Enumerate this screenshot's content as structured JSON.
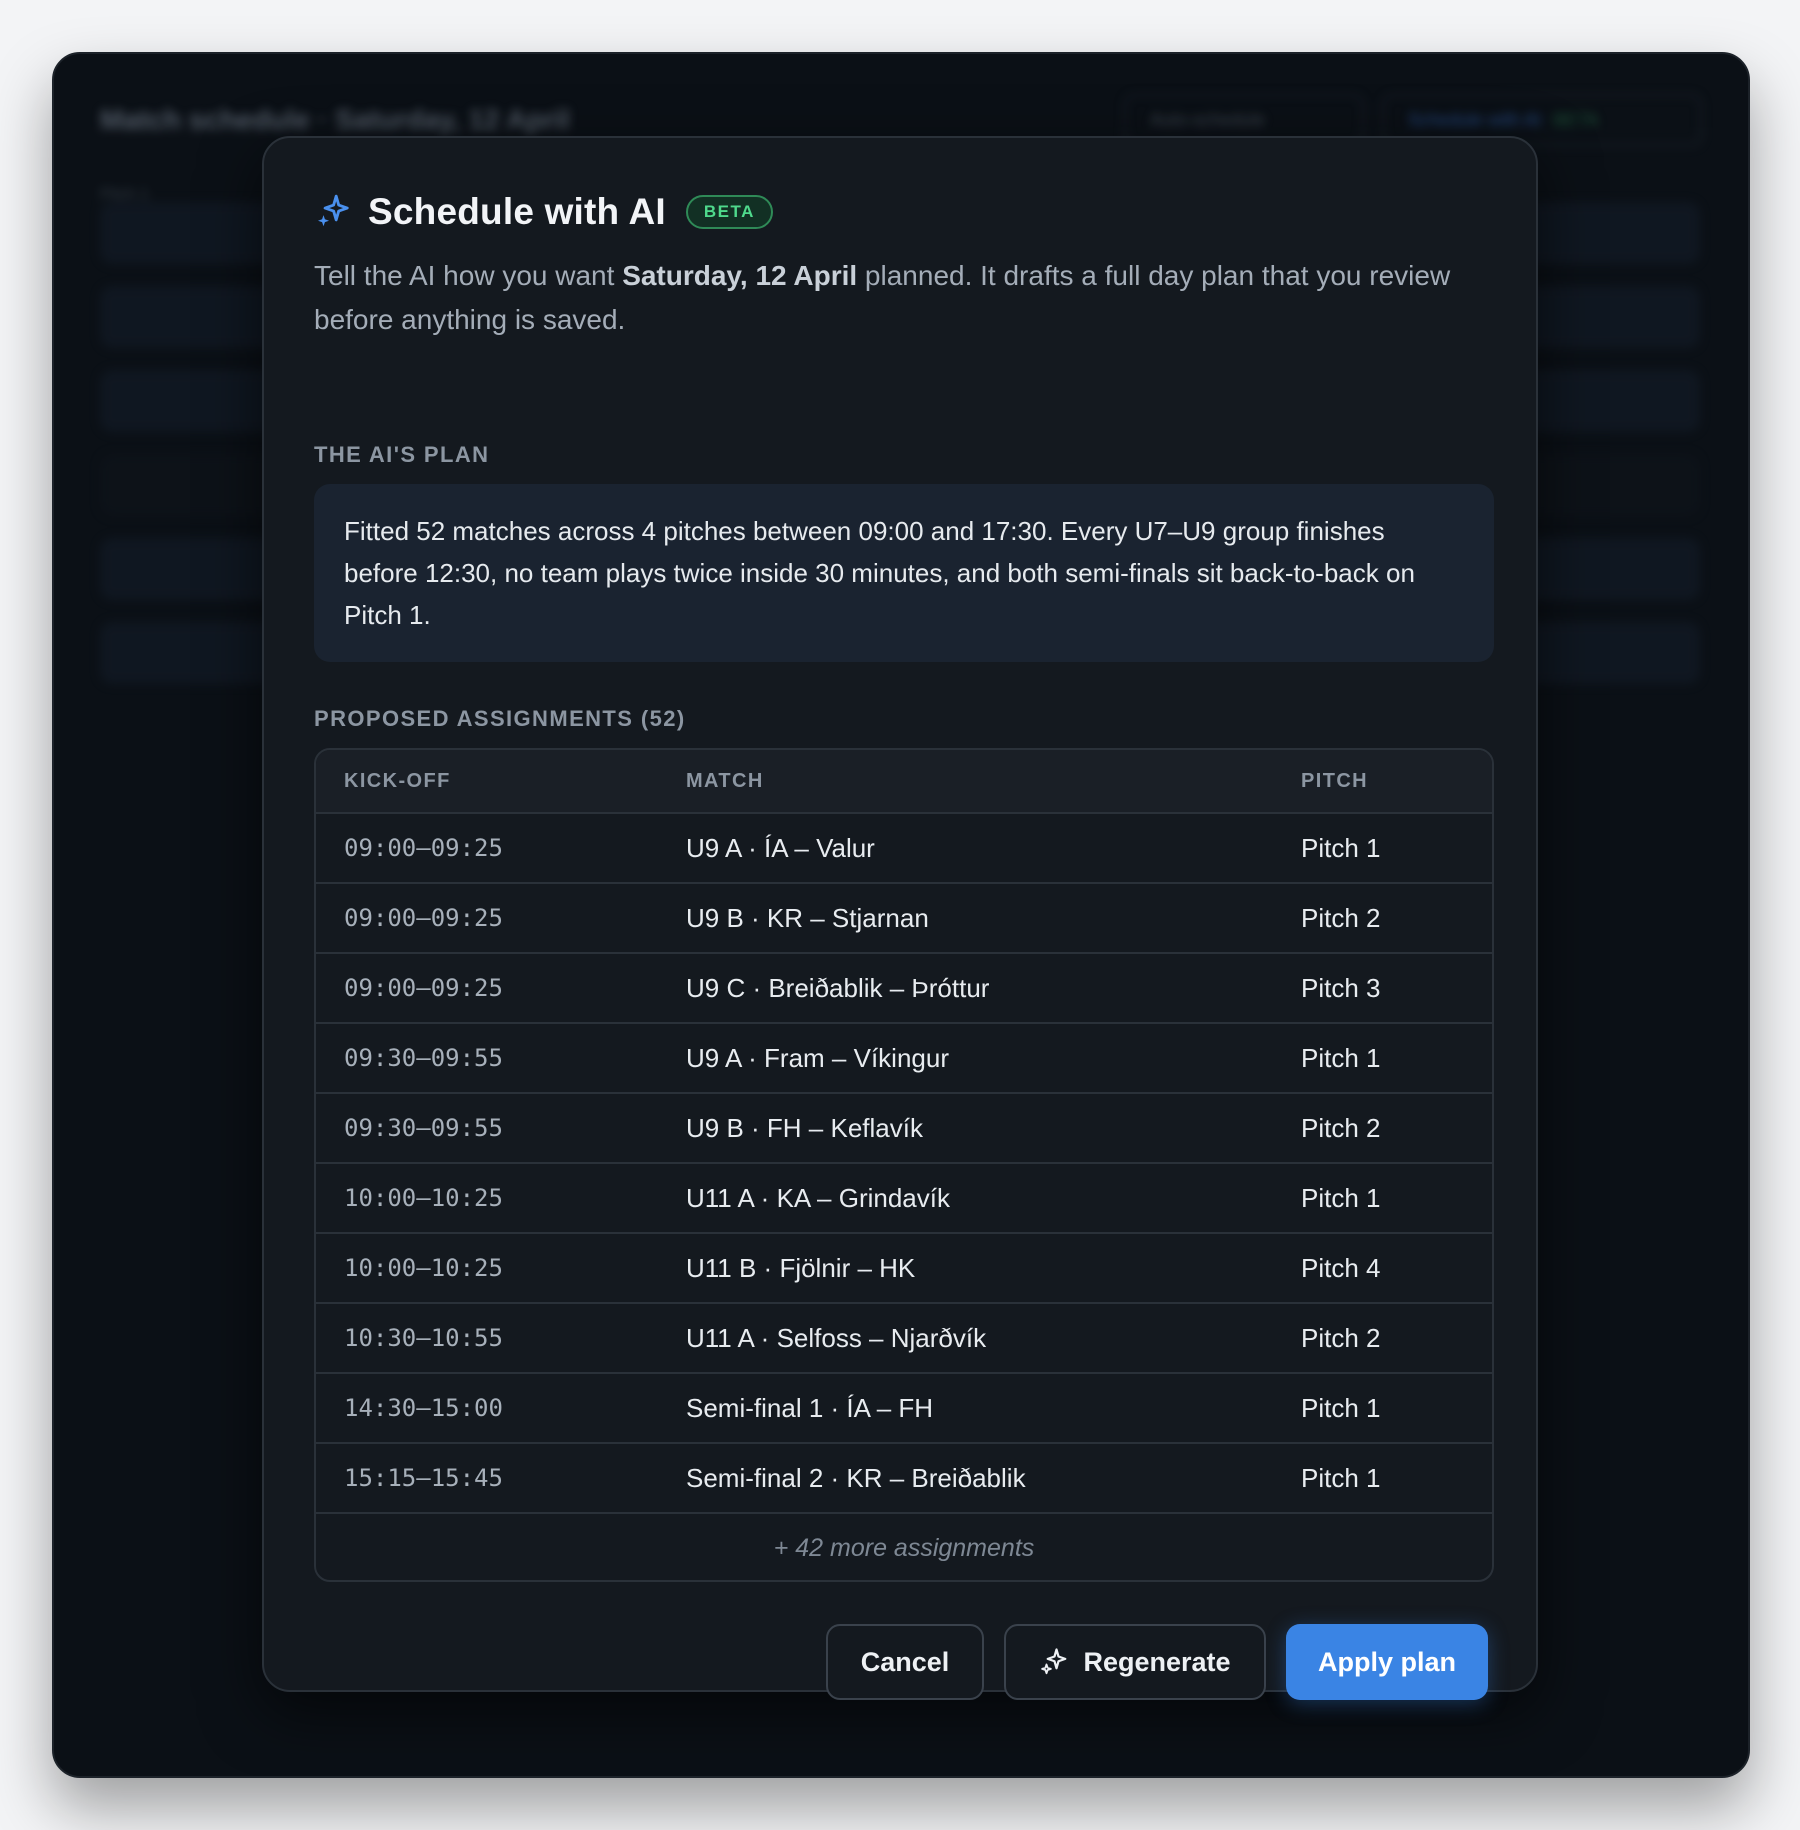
{
  "background": {
    "page_title": "Match schedule · Saturday, 12 April",
    "auto_schedule_label": "Auto-schedule",
    "schedule_ai_label": "Schedule with AI",
    "beta_label": "BETA",
    "subheading": "Pitch 1"
  },
  "modal": {
    "title": "Schedule with AI",
    "badge": "BETA",
    "intro_prefix": "Tell the AI how you want ",
    "intro_date": "Saturday, 12 April",
    "intro_suffix": " planned. It drafts a full day plan that you review before anything is saved.",
    "plan_label": "THE AI'S PLAN",
    "plan_text": "Fitted 52 matches across 4 pitches between 09:00 and 17:30. Every U7–U9 group finishes before 12:30, no team plays twice inside 30 minutes, and both semi-finals sit back-to-back on Pitch 1.",
    "assignments_label": "PROPOSED ASSIGNMENTS (52)",
    "table": {
      "headers": {
        "kickoff": "KICK-OFF",
        "match": "MATCH",
        "pitch": "PITCH"
      },
      "rows": [
        {
          "kickoff": "09:00–09:25",
          "match": "U9 A · ÍA – Valur",
          "pitch": "Pitch 1"
        },
        {
          "kickoff": "09:00–09:25",
          "match": "U9 B · KR – Stjarnan",
          "pitch": "Pitch 2"
        },
        {
          "kickoff": "09:00–09:25",
          "match": "U9 C · Breiðablik – Þróttur",
          "pitch": "Pitch 3"
        },
        {
          "kickoff": "09:30–09:55",
          "match": "U9 A · Fram – Víkingur",
          "pitch": "Pitch 1"
        },
        {
          "kickoff": "09:30–09:55",
          "match": "U9 B · FH – Keflavík",
          "pitch": "Pitch 2"
        },
        {
          "kickoff": "10:00–10:25",
          "match": "U11 A · KA – Grindavík",
          "pitch": "Pitch 1"
        },
        {
          "kickoff": "10:00–10:25",
          "match": "U11 B · Fjölnir – HK",
          "pitch": "Pitch 4"
        },
        {
          "kickoff": "10:30–10:55",
          "match": "U11 A · Selfoss – Njarðvík",
          "pitch": "Pitch 2"
        },
        {
          "kickoff": "14:30–15:00",
          "match": "Semi-final 1 · ÍA – FH",
          "pitch": "Pitch 1"
        },
        {
          "kickoff": "15:15–15:45",
          "match": "Semi-final 2 · KR – Breiðablik",
          "pitch": "Pitch 1"
        }
      ],
      "more": "+ 42 more assignments"
    },
    "buttons": {
      "cancel": "Cancel",
      "regenerate": "Regenerate",
      "apply": "Apply plan"
    }
  },
  "colors": {
    "accent": "#3a84e4",
    "beta_green": "#4fd98c",
    "surface": "#14191f"
  },
  "icons": {
    "title_icon": "sparkle-icon",
    "regenerate_icon": "sparkle-icon"
  }
}
